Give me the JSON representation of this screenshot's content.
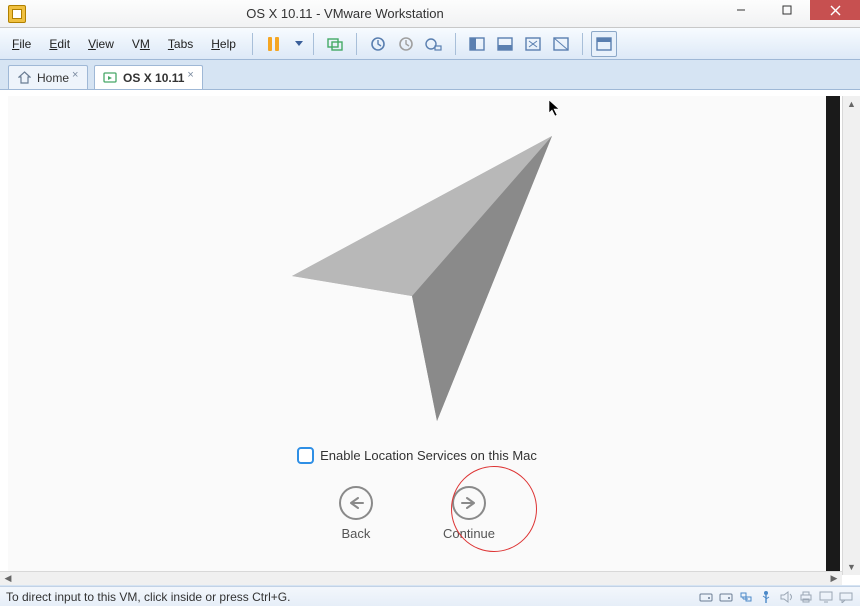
{
  "window": {
    "title": "OS X 10.11 - VMware Workstation"
  },
  "menus": {
    "file": "File",
    "edit": "Edit",
    "view": "View",
    "vm": "VM",
    "tabs": "Tabs",
    "help": "Help"
  },
  "tabs": {
    "home": "Home",
    "vm": "OS X 10.11"
  },
  "setup": {
    "checkbox_label": "Enable Location Services on this Mac",
    "back": "Back",
    "continue": "Continue"
  },
  "status": {
    "msg": "To direct input to this VM, click inside or press Ctrl+G."
  },
  "icons": {
    "location": "location-arrow-icon",
    "back": "arrow-left-icon",
    "forward": "arrow-right-icon"
  }
}
